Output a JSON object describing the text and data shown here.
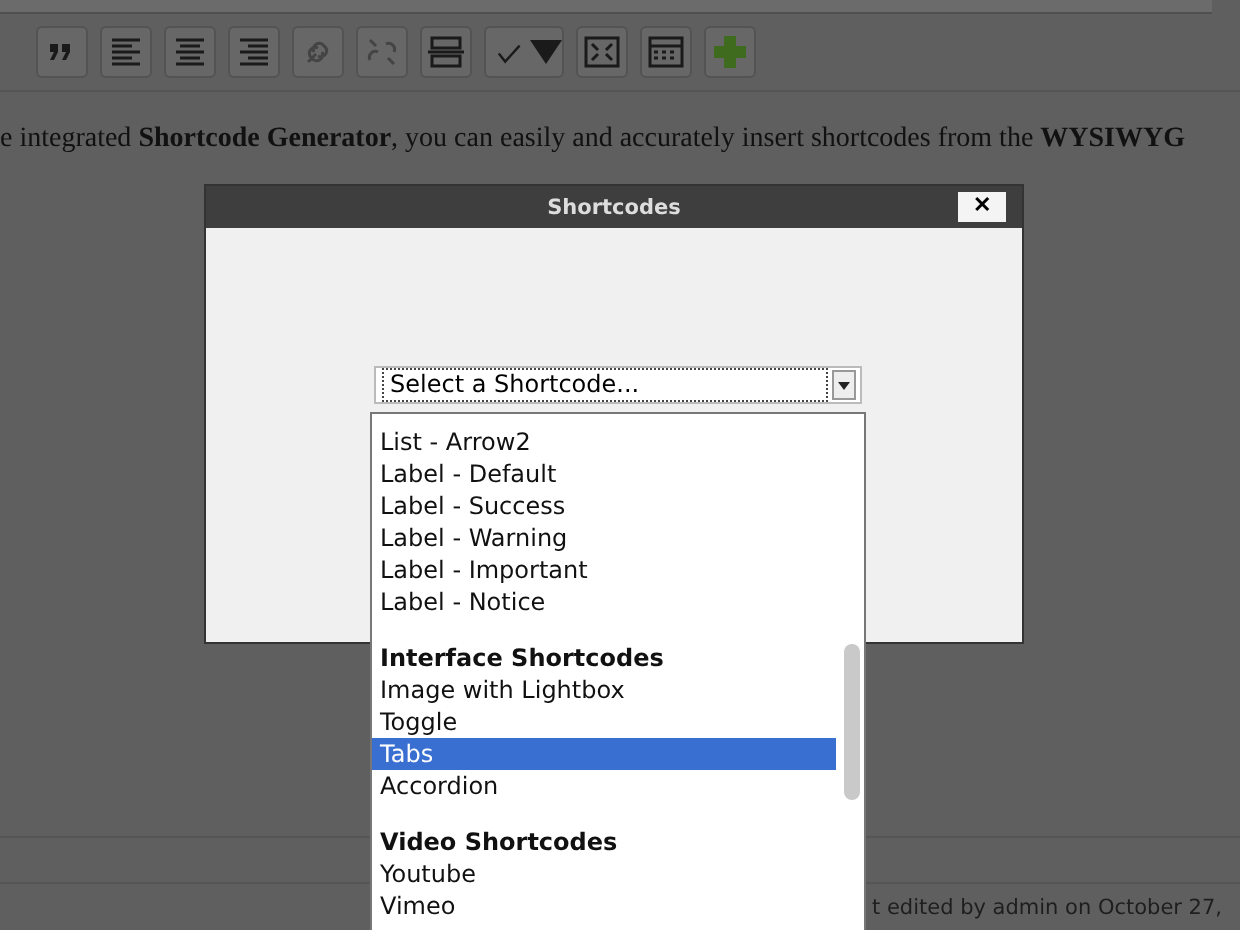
{
  "toolbar": {
    "buttons": [
      {
        "kind": "quote",
        "disabled": false
      },
      {
        "kind": "align-left",
        "disabled": false
      },
      {
        "kind": "align-center",
        "disabled": false
      },
      {
        "kind": "align-right",
        "disabled": false
      },
      {
        "kind": "link",
        "disabled": true
      },
      {
        "kind": "unlink",
        "disabled": true
      },
      {
        "kind": "more",
        "disabled": false
      },
      {
        "kind": "spellcheck",
        "disabled": false
      },
      {
        "kind": "fullscreen",
        "disabled": false
      },
      {
        "kind": "kitchen-sink",
        "disabled": false
      },
      {
        "kind": "add",
        "disabled": false
      }
    ]
  },
  "paragraph": "e integrated **Shortcode Generator**, you can easily and accurately insert shortcodes from the **WYSIWYG**",
  "dialog": {
    "title": "Shortcodes",
    "close": "✕",
    "select": {
      "value": "Select a Shortcode..."
    },
    "options": [
      {
        "kind": "option",
        "label": "List - Arrow2",
        "selected": false
      },
      {
        "kind": "option",
        "label": "Label - Default",
        "selected": false
      },
      {
        "kind": "option",
        "label": "Label - Success",
        "selected": false
      },
      {
        "kind": "option",
        "label": "Label - Warning",
        "selected": false
      },
      {
        "kind": "option",
        "label": "Label - Important",
        "selected": false
      },
      {
        "kind": "option",
        "label": "Label - Notice",
        "selected": false
      },
      {
        "kind": "group",
        "label": "Interface Shortcodes"
      },
      {
        "kind": "option",
        "label": "Image with Lightbox",
        "selected": false
      },
      {
        "kind": "option",
        "label": "Toggle",
        "selected": false
      },
      {
        "kind": "option",
        "label": "Tabs",
        "selected": true
      },
      {
        "kind": "option",
        "label": "Accordion",
        "selected": false
      },
      {
        "kind": "group",
        "label": "Video Shortcodes"
      },
      {
        "kind": "option",
        "label": "Youtube",
        "selected": false
      },
      {
        "kind": "option",
        "label": "Vimeo",
        "selected": false
      }
    ]
  },
  "status_bar": {
    "text": "t edited by admin on October 27,"
  }
}
